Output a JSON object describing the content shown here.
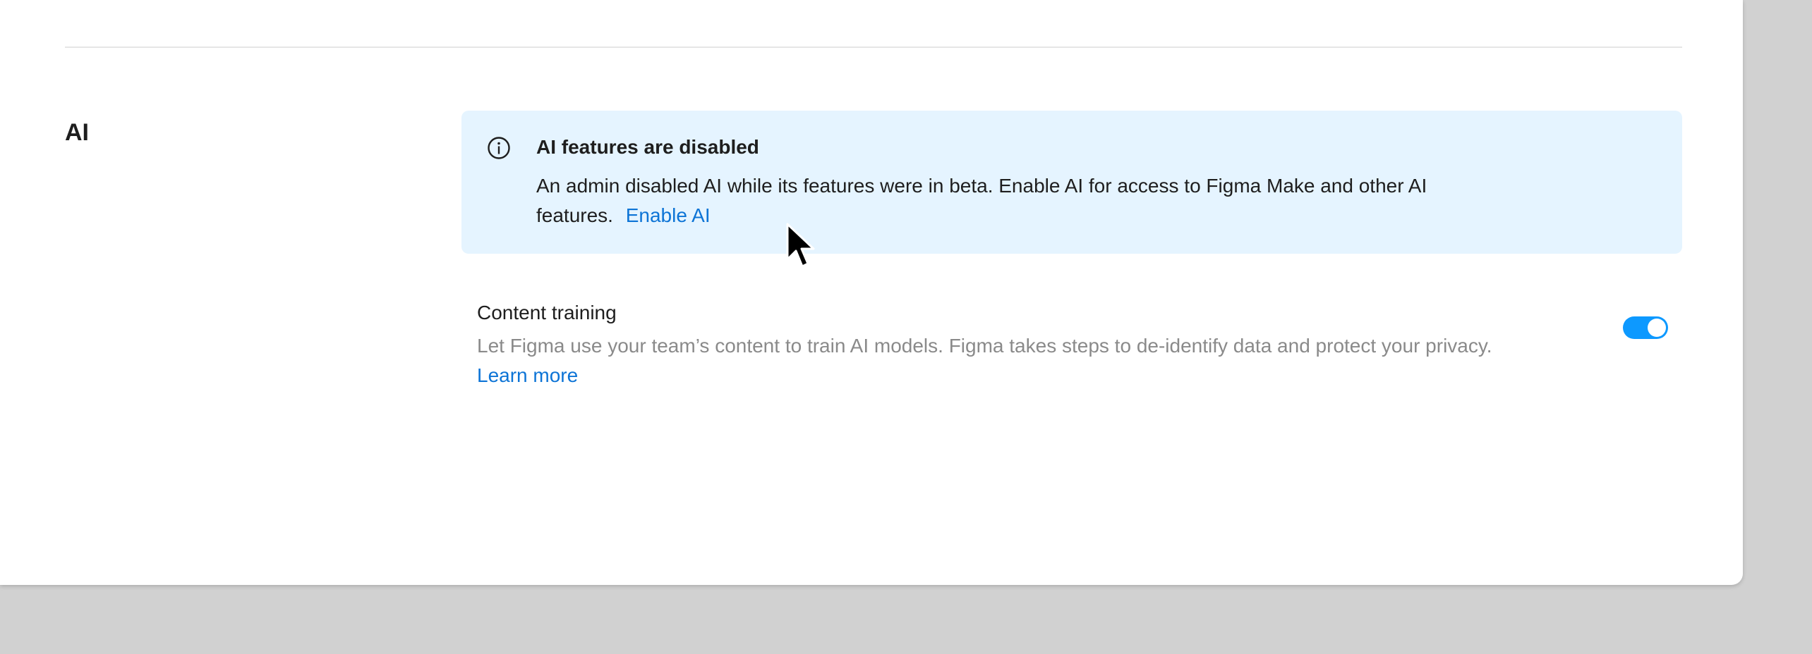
{
  "section": {
    "title": "AI"
  },
  "banner": {
    "icon": "info-icon",
    "title": "AI features are disabled",
    "body": "An admin disabled AI while its features were in beta. Enable AI for access to Figma Make and other AI features.",
    "link_label": "Enable AI",
    "background_color": "#e5f4ff"
  },
  "content_training": {
    "title": "Content training",
    "description": "Let Figma use your team’s content to train AI models. Figma takes steps to de-identify data and protect your privacy.",
    "link_label": "Learn more",
    "toggle_on": true,
    "toggle_color": "#0d99ff"
  },
  "colors": {
    "link": "#0d74d6",
    "page_background": "#d1d1d1",
    "panel_background": "#ffffff"
  },
  "cursor": {
    "icon": "mouse-pointer-icon"
  }
}
